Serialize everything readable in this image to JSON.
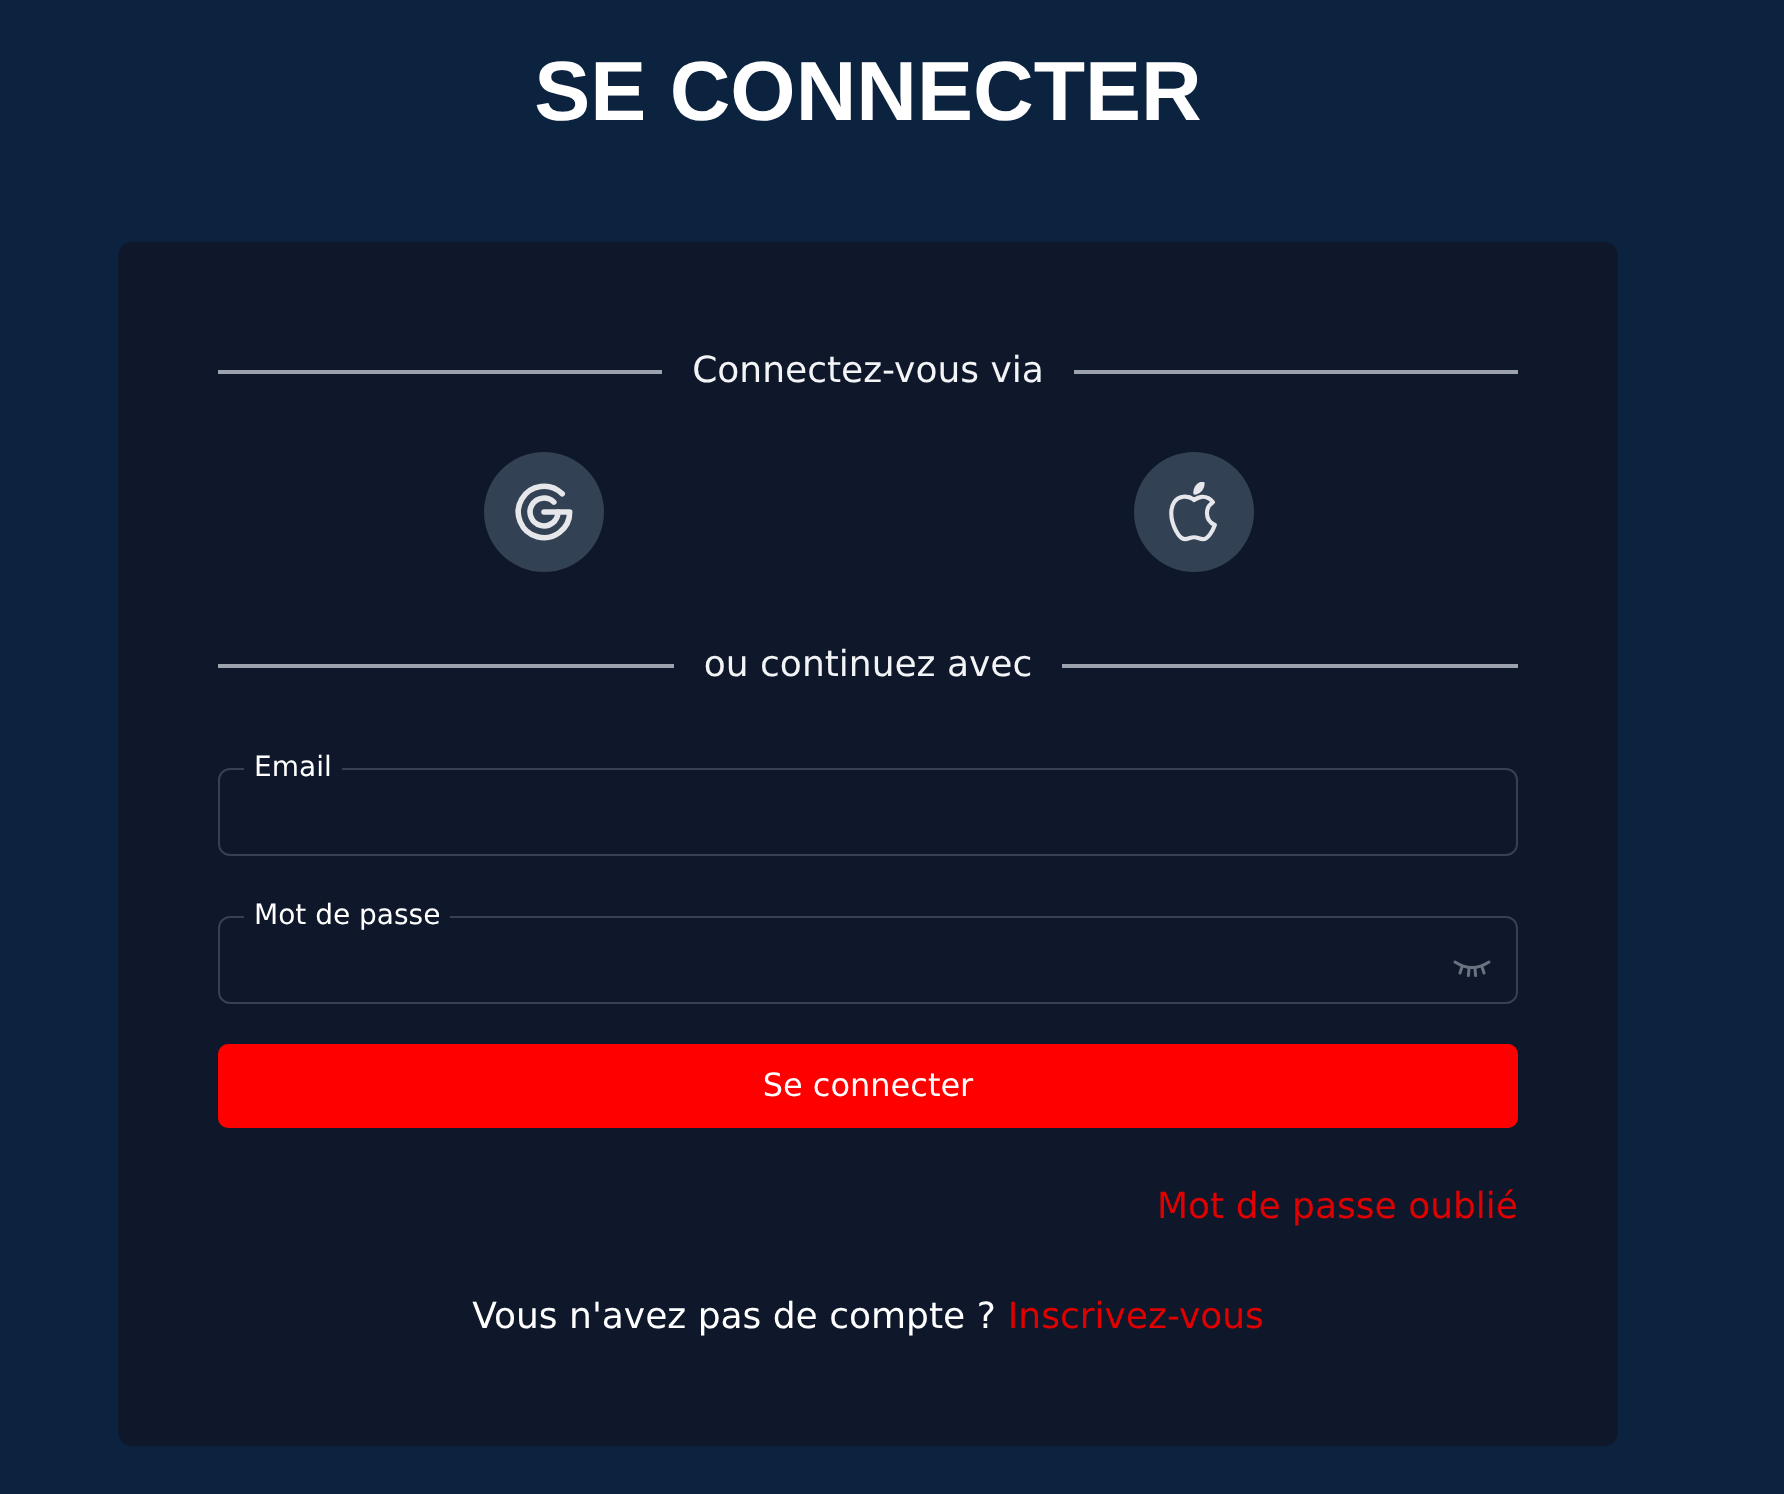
{
  "title": "SE CONNECTER",
  "card": {
    "social_divider": "Connectez-vous via",
    "social_buttons": [
      {
        "kind": "google"
      },
      {
        "kind": "apple"
      }
    ],
    "form_divider": "ou continuez avec",
    "fields": [
      {
        "kind": "email",
        "label": "Email"
      },
      {
        "kind": "password",
        "label": "Mot de passe"
      }
    ],
    "submit": "Se connecter",
    "forgot_link": "Mot de passe oublié",
    "signup": {
      "text": "Vous n'avez pas de compte ?",
      "link": "Inscrivez-vous"
    }
  }
}
